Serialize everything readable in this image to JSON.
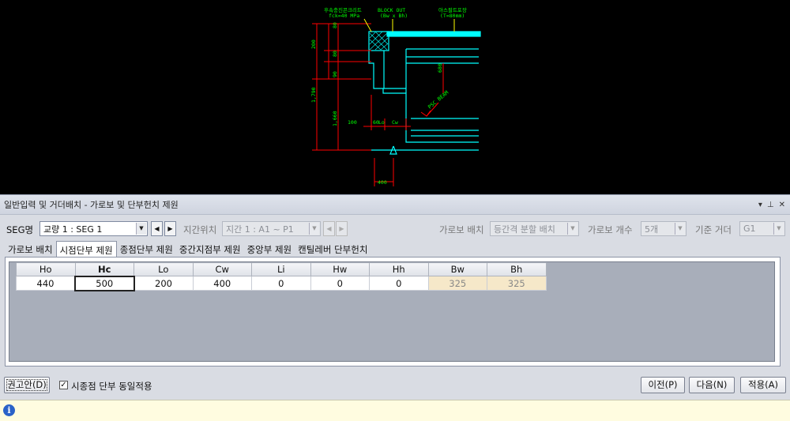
{
  "drawing": {
    "labels": {
      "concrete": "후속충진콘크리트",
      "concrete_spec": "fck=40 MPa",
      "blockout": "BLOCK OUT",
      "blockout_dim": "(Bw x Bh)",
      "asphalt": "아스팔트포장",
      "asphalt_thk": "(T=80mm)",
      "beam": "PSC BEAM",
      "d200": "200",
      "d80": "80",
      "d80b": "80",
      "d90": "90",
      "d1790": "1,790",
      "d1660": "1,660",
      "d680": "680",
      "d100": "100",
      "d60": "60",
      "lo": "Lo",
      "cw": "Cw",
      "d400": "400"
    }
  },
  "panel": {
    "title": "일반입력 및 거더배치 - 가로보 및 단부헌치 제원",
    "title_buttons": [
      "▾",
      "⊥",
      "✕"
    ]
  },
  "toolbar": {
    "seg_label": "SEG명",
    "seg_value": "교량 1 : SEG 1",
    "span_label": "지간위치",
    "span_value": "지간 1 : A1 ~ P1",
    "crossbeam_layout_label": "가로보 배치",
    "crossbeam_layout_value": "등간격 분할 배치",
    "crossbeam_count_label": "가로보 개수",
    "crossbeam_count_value": "5개",
    "base_girder_label": "기준 거더",
    "base_girder_value": "G1"
  },
  "tabs": [
    "가로보 배치",
    "시점단부 제원",
    "종점단부 제원",
    "중간지점부 제원",
    "중앙부 제원",
    "캔틸레버 단부헌치"
  ],
  "active_tab": "시점단부 제원",
  "grid": {
    "columns": [
      "Ho",
      "Hc",
      "Lo",
      "Cw",
      "Li",
      "Hw",
      "Hh",
      "Bw",
      "Bh"
    ],
    "row": [
      "440",
      "500",
      "200",
      "400",
      "0",
      "0",
      "0",
      "325",
      "325"
    ]
  },
  "footer": {
    "recommend_button": "권고안(D)",
    "same_apply_label": "시종점 단부 동일적용",
    "same_apply_checked": true,
    "prev_button": "이전(P)",
    "next_button": "다음(N)",
    "apply_button": "적용(A)"
  },
  "colors": {
    "cad_bg": "#000000",
    "cad_cyan": "#00ffff",
    "cad_red": "#ff0000",
    "cad_green": "#00ff00",
    "cad_yellow": "#ffff00",
    "readonly_cell": "#f6e8c9"
  }
}
